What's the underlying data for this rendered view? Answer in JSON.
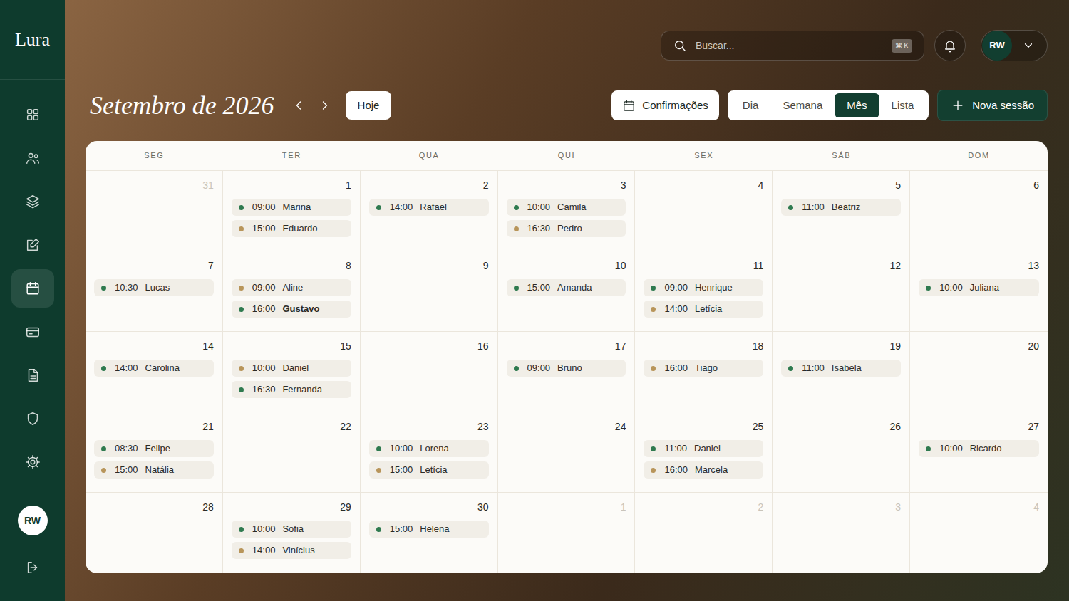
{
  "brand": "Lura",
  "sidebar": {
    "items": [
      {
        "selected": false
      },
      {
        "selected": false
      },
      {
        "selected": false
      },
      {
        "selected": false
      },
      {
        "selected": true
      },
      {
        "selected": false
      },
      {
        "selected": false
      },
      {
        "selected": false
      },
      {
        "selected": false
      }
    ],
    "user": {
      "initials": "RW"
    }
  },
  "search": {
    "placeholder": "Buscar...",
    "shortcut": "⌘ K"
  },
  "topbar": {
    "user": {
      "initials": "RW"
    }
  },
  "header": {
    "title": "Setembro de 2026",
    "today": "Hoje",
    "confirmations": "Confirmações",
    "views": [
      {
        "label": "Dia",
        "selected": false
      },
      {
        "label": "Semana",
        "selected": false
      },
      {
        "label": "Mês",
        "selected": true
      },
      {
        "label": "Lista",
        "selected": false
      }
    ],
    "new_session": "Nova sessão"
  },
  "calendar": {
    "weekdays": [
      "SEG",
      "TER",
      "QUA",
      "QUI",
      "SEX",
      "SÁB",
      "DOM"
    ],
    "weeks": [
      [
        {
          "day": "31",
          "outside": true,
          "events": []
        },
        {
          "day": "1",
          "outside": false,
          "events": [
            {
              "time": "09:00",
              "name": "Marina",
              "color": "#2f7a4f",
              "highlighted": false
            },
            {
              "time": "15:00",
              "name": "Eduardo",
              "color": "#b8955a",
              "highlighted": false
            }
          ]
        },
        {
          "day": "2",
          "outside": false,
          "events": [
            {
              "time": "14:00",
              "name": "Rafael",
              "color": "#2f7a4f",
              "highlighted": false
            }
          ]
        },
        {
          "day": "3",
          "outside": false,
          "events": [
            {
              "time": "10:00",
              "name": "Camila",
              "color": "#2f7a4f",
              "highlighted": false
            },
            {
              "time": "16:30",
              "name": "Pedro",
              "color": "#b8955a",
              "highlighted": false
            }
          ]
        },
        {
          "day": "4",
          "outside": false,
          "events": []
        },
        {
          "day": "5",
          "outside": false,
          "events": [
            {
              "time": "11:00",
              "name": "Beatriz",
              "color": "#2f7a4f",
              "highlighted": false
            }
          ]
        },
        {
          "day": "6",
          "outside": false,
          "events": []
        }
      ],
      [
        {
          "day": "7",
          "outside": false,
          "events": [
            {
              "time": "10:30",
              "name": "Lucas",
              "color": "#2f7a4f",
              "highlighted": false
            }
          ]
        },
        {
          "day": "8",
          "outside": false,
          "events": [
            {
              "time": "09:00",
              "name": "Aline",
              "color": "#b8955a",
              "highlighted": false
            },
            {
              "time": "16:00",
              "name": "Gustavo",
              "color": "#2f7a4f",
              "highlighted": true
            }
          ]
        },
        {
          "day": "9",
          "outside": false,
          "events": []
        },
        {
          "day": "10",
          "outside": false,
          "events": [
            {
              "time": "15:00",
              "name": "Amanda",
              "color": "#2f7a4f",
              "highlighted": false
            }
          ]
        },
        {
          "day": "11",
          "outside": false,
          "events": [
            {
              "time": "09:00",
              "name": "Henrique",
              "color": "#2f7a4f",
              "highlighted": false
            },
            {
              "time": "14:00",
              "name": "Letícia",
              "color": "#b8955a",
              "highlighted": false
            }
          ]
        },
        {
          "day": "12",
          "outside": false,
          "events": []
        },
        {
          "day": "13",
          "outside": false,
          "events": [
            {
              "time": "10:00",
              "name": "Juliana",
              "color": "#2f7a4f",
              "highlighted": false
            }
          ]
        }
      ],
      [
        {
          "day": "14",
          "outside": false,
          "events": [
            {
              "time": "14:00",
              "name": "Carolina",
              "color": "#2f7a4f",
              "highlighted": false
            }
          ]
        },
        {
          "day": "15",
          "outside": false,
          "events": [
            {
              "time": "10:00",
              "name": "Daniel",
              "color": "#b8955a",
              "highlighted": false
            },
            {
              "time": "16:30",
              "name": "Fernanda",
              "color": "#2f7a4f",
              "highlighted": false
            }
          ]
        },
        {
          "day": "16",
          "outside": false,
          "events": []
        },
        {
          "day": "17",
          "outside": false,
          "events": [
            {
              "time": "09:00",
              "name": "Bruno",
              "color": "#2f7a4f",
              "highlighted": false
            }
          ]
        },
        {
          "day": "18",
          "outside": false,
          "events": [
            {
              "time": "16:00",
              "name": "Tiago",
              "color": "#b8955a",
              "highlighted": false
            }
          ]
        },
        {
          "day": "19",
          "outside": false,
          "events": [
            {
              "time": "11:00",
              "name": "Isabela",
              "color": "#2f7a4f",
              "highlighted": false
            }
          ]
        },
        {
          "day": "20",
          "outside": false,
          "events": []
        }
      ],
      [
        {
          "day": "21",
          "outside": false,
          "events": [
            {
              "time": "08:30",
              "name": "Felipe",
              "color": "#2f7a4f",
              "highlighted": false
            },
            {
              "time": "15:00",
              "name": "Natália",
              "color": "#b8955a",
              "highlighted": false
            }
          ]
        },
        {
          "day": "22",
          "outside": false,
          "events": []
        },
        {
          "day": "23",
          "outside": false,
          "events": [
            {
              "time": "10:00",
              "name": "Lorena",
              "color": "#2f7a4f",
              "highlighted": false
            },
            {
              "time": "15:00",
              "name": "Letícia",
              "color": "#b8955a",
              "highlighted": false
            }
          ]
        },
        {
          "day": "24",
          "outside": false,
          "events": []
        },
        {
          "day": "25",
          "outside": false,
          "events": [
            {
              "time": "11:00",
              "name": "Daniel",
              "color": "#2f7a4f",
              "highlighted": false
            },
            {
              "time": "16:00",
              "name": "Marcela",
              "color": "#b8955a",
              "highlighted": false
            }
          ]
        },
        {
          "day": "26",
          "outside": false,
          "events": []
        },
        {
          "day": "27",
          "outside": false,
          "events": [
            {
              "time": "10:00",
              "name": "Ricardo",
              "color": "#2f7a4f",
              "highlighted": false
            }
          ]
        }
      ],
      [
        {
          "day": "28",
          "outside": false,
          "events": []
        },
        {
          "day": "29",
          "outside": false,
          "events": [
            {
              "time": "10:00",
              "name": "Sofia",
              "color": "#2f7a4f",
              "highlighted": false
            },
            {
              "time": "14:00",
              "name": "Vinícius",
              "color": "#b8955a",
              "highlighted": false
            }
          ]
        },
        {
          "day": "30",
          "outside": false,
          "events": [
            {
              "time": "15:00",
              "name": "Helena",
              "color": "#2f7a4f",
              "highlighted": false
            }
          ]
        },
        {
          "day": "1",
          "outside": true,
          "events": []
        },
        {
          "day": "2",
          "outside": true,
          "events": []
        },
        {
          "day": "3",
          "outside": true,
          "events": []
        },
        {
          "day": "4",
          "outside": true,
          "events": []
        }
      ]
    ]
  }
}
